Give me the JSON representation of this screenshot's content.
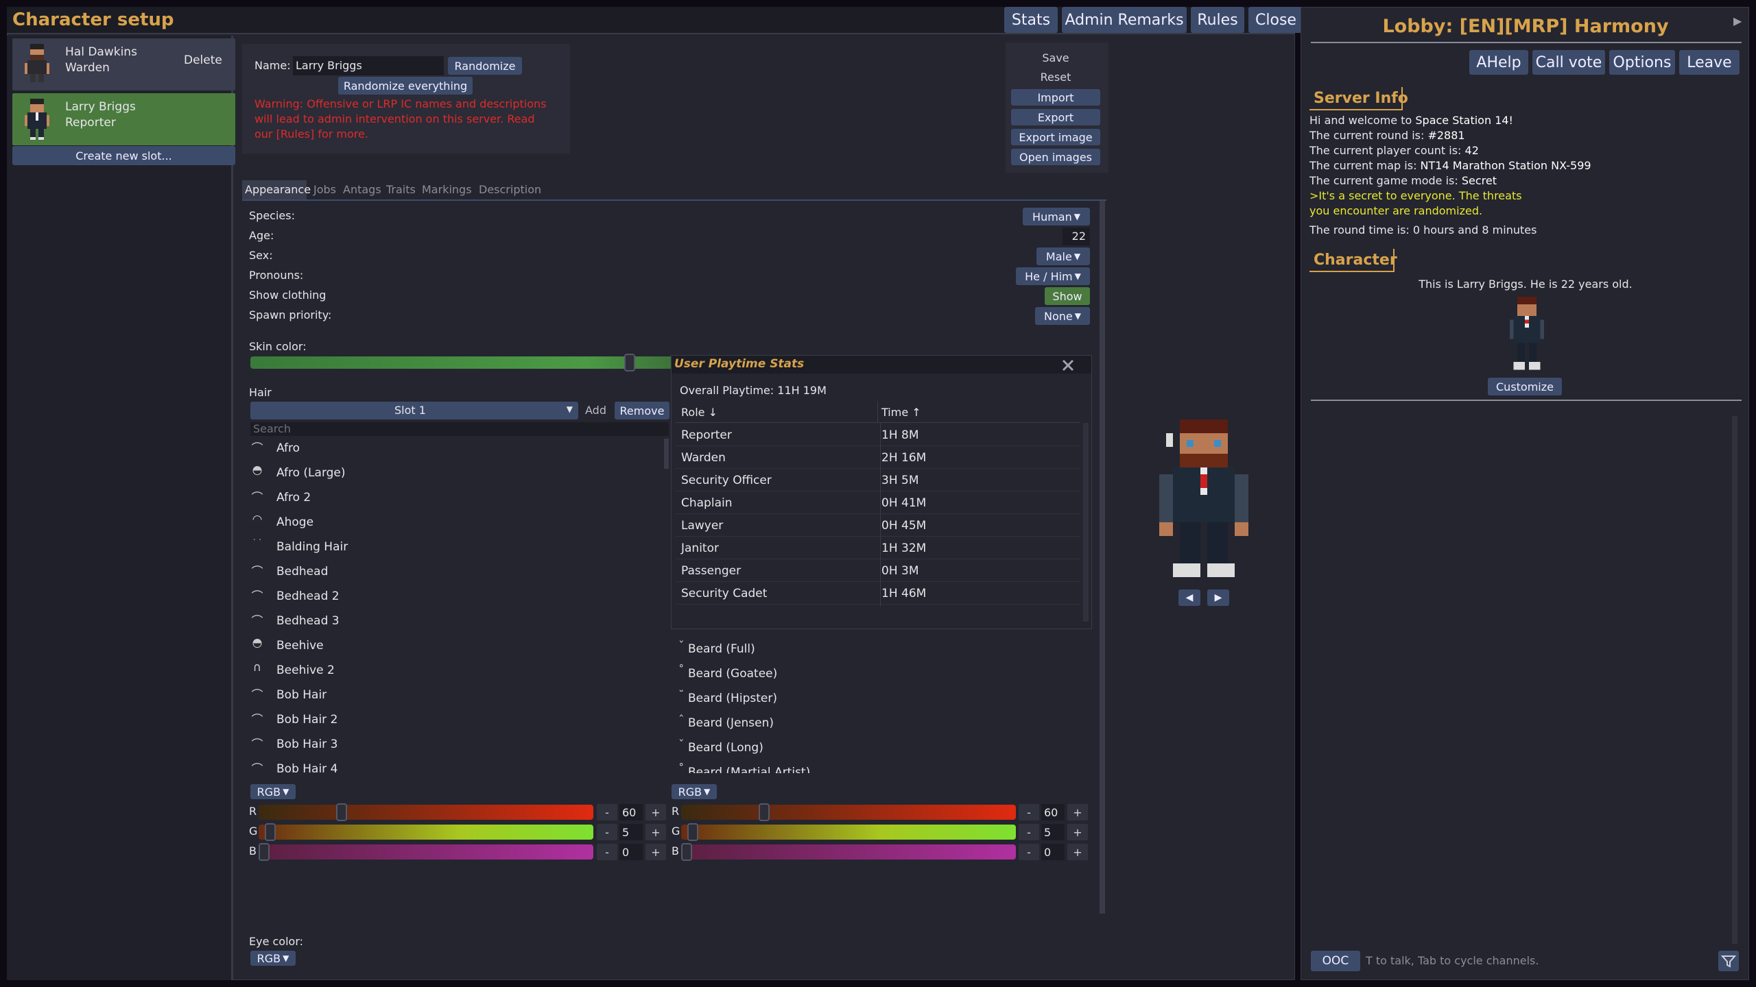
{
  "window": {
    "title": "Character setup",
    "top_buttons": [
      "Stats",
      "Admin Remarks",
      "Rules",
      "Close"
    ]
  },
  "sidebar": {
    "slots": [
      {
        "name": "Hal Dawkins",
        "job": "Warden",
        "action": "Delete",
        "selected": false
      },
      {
        "name": "Larry Briggs",
        "job": "Reporter",
        "action": "",
        "selected": true
      }
    ],
    "create_label": "Create new slot..."
  },
  "name_box": {
    "label": "Name:",
    "value": "Larry Briggs",
    "randomize_label": "Randomize",
    "randomize_all_label": "Randomize everything",
    "warning": "Warning: Offensive or LRP IC names and descriptions will lead to admin intervention on this server. Read our [Rules] for more."
  },
  "actions": {
    "save": "Save",
    "reset": "Reset",
    "import": "Import",
    "export": "Export",
    "export_image": "Export image",
    "open_images": "Open images"
  },
  "tabs": [
    "Appearance",
    "Jobs",
    "Antags",
    "Traits",
    "Markings",
    "Description"
  ],
  "appearance": {
    "species_label": "Species:",
    "species_value": "Human",
    "age_label": "Age:",
    "age_value": "22",
    "sex_label": "Sex:",
    "sex_value": "Male",
    "pronouns_label": "Pronouns:",
    "pronouns_value": "He / Him",
    "clothing_label": "Show clothing",
    "clothing_value": "Show",
    "spawn_label": "Spawn priority:",
    "spawn_value": "None",
    "skin_label": "Skin color:",
    "hair_label": "Hair",
    "slot_value": "Slot 1",
    "add_label": "Add",
    "remove_label": "Remove",
    "search_placeholder": "Search",
    "eye_label": "Eye color:",
    "rgb_label": "RGB"
  },
  "hair_list": [
    "Afro",
    "Afro (Large)",
    "Afro 2",
    "Ahoge",
    "Balding Hair",
    "Bedhead",
    "Bedhead 2",
    "Bedhead 3",
    "Beehive",
    "Beehive 2",
    "Bob Hair",
    "Bob Hair 2",
    "Bob Hair 3",
    "Bob Hair 4"
  ],
  "facial_list": [
    "Beard (Full)",
    "Beard (Goatee)",
    "Beard (Hipster)",
    "Beard (Jensen)",
    "Beard (Long)",
    "Beard (Martial Artist)"
  ],
  "color_left": {
    "r": "60",
    "g": "5",
    "b": "0",
    "r_frac": 0.24,
    "g_frac": 0.02,
    "b_frac": 0.0
  },
  "color_right": {
    "r": "60",
    "g": "5",
    "b": "0",
    "r_frac": 0.24,
    "g_frac": 0.02,
    "b_frac": 0.0
  },
  "channel_letters": {
    "r": "R",
    "g": "G",
    "b": "B"
  },
  "stepper": {
    "minus": "-",
    "plus": "+"
  },
  "playtime": {
    "title": "User Playtime Stats",
    "overall": "Overall Playtime: 11H 19M",
    "col_role": "Role ↓",
    "col_time": "Time ↑",
    "rows": [
      {
        "role": "Reporter",
        "time": "1H 8M"
      },
      {
        "role": "Warden",
        "time": "2H 16M"
      },
      {
        "role": "Security Officer",
        "time": "3H 5M"
      },
      {
        "role": "Chaplain",
        "time": "0H 41M"
      },
      {
        "role": "Lawyer",
        "time": "0H 45M"
      },
      {
        "role": "Janitor",
        "time": "1H 32M"
      },
      {
        "role": "Passenger",
        "time": "0H 3M"
      },
      {
        "role": "Security Cadet",
        "time": "1H 46M"
      }
    ]
  },
  "lobby": {
    "title": "Lobby: [EN][MRP] Harmony",
    "buttons": [
      "AHelp",
      "Call vote",
      "Options",
      "Leave"
    ],
    "server_info_heading": "Server Info",
    "welcome_pre": "Hi and welcome to ",
    "welcome_name": "Space Station 14!",
    "round_pre": "The current round is: ",
    "round_val": "#2881",
    "count_pre": "The current player count is: ",
    "count_val": "42",
    "map_pre": "The current map is: ",
    "map_val": "NT14 Marathon Station NX-599",
    "mode_pre": "The current game mode is: ",
    "mode_val": "Secret",
    "secret_line": ">It's a secret to everyone. The threats you encounter are randomized.",
    "round_time": "The round time is: 0 hours and 8 minutes",
    "character_heading": "Character",
    "character_desc": "This is Larry Briggs. He is 22 years old.",
    "customize_label": "Customize",
    "chat_channel": "OOC",
    "chat_placeholder": "T to talk, Tab to cycle channels."
  },
  "colors": {
    "accent_title": "#d8a34b",
    "selected_slot": "#4a7a3e",
    "warning": "#e02a2a",
    "secret": "#e8e830",
    "button": "#3d4b6b"
  }
}
